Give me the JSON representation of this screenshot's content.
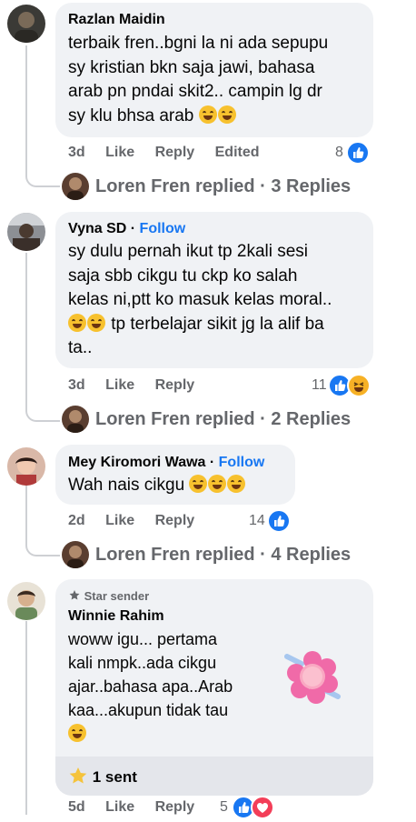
{
  "comments": [
    {
      "author": "Razlan Maidin",
      "follow": "",
      "text": "terbaik fren..bgni la ni ada sepupu\nsy kristian bkn saja jawi, bahasa\narab pn pndai skit2.. campin lg dr\nsy klu bhsa arab",
      "time": "3d",
      "like": "Like",
      "reply": "Reply",
      "edited": "Edited",
      "reaction_count": "8",
      "replies": "Loren Fren replied · 3 Replies"
    },
    {
      "author": "Vyna SD",
      "follow": "Follow",
      "text": "sy dulu pernah ikut tp 2kali sesi\nsaja sbb cikgu tu ckp ko salah\nkelas ni,ptt ko masuk kelas moral..",
      "text_cont": " tp terbelajar sikit jg la alif ba",
      "text_end": "ta..",
      "time": "3d",
      "like": "Like",
      "reply": "Reply",
      "reaction_count": "11",
      "replies": "Loren Fren replied · 2 Replies"
    },
    {
      "author": "Mey Kiromori Wawa",
      "follow": "Follow",
      "text": "Wah nais cikgu",
      "time": "2d",
      "like": "Like",
      "reply": "Reply",
      "reaction_count": "14",
      "replies": "Loren Fren replied · 4 Replies"
    },
    {
      "badge": "Star sender",
      "author": "Winnie Rahim",
      "text": "woww igu... pertama\nkali nmpk..ada cikgu\najar..bahasa apa..Arab\nkaa...akupun tidak tau",
      "stars": "1 sent",
      "time": "5d",
      "like": "Like",
      "reply": "Reply",
      "reaction_count": "5"
    }
  ],
  "separator": "·",
  "icons": [
    "like-icon",
    "haha-icon",
    "love-icon",
    "star-icon",
    "flower-sticker"
  ],
  "colors": {
    "accent": "#1877f2",
    "bubble": "#f0f2f5",
    "meta": "#65676b"
  }
}
